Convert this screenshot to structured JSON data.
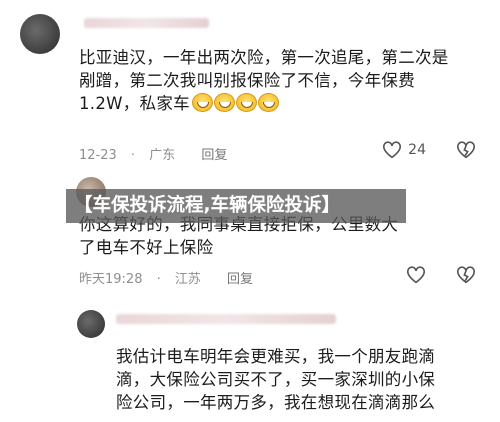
{
  "comments": [
    {
      "text_lines": [
        "比亚迪汉，一年出两次险，第一次追尾，第二次是",
        "剐蹭，第二次我叫别报保险了不信，今年保费",
        "1.2W，私家车"
      ],
      "time": "12-23",
      "location": "广东",
      "reply_label": "回复",
      "likes": "24"
    },
    {
      "text_lines": [
        "你这算好的，我同事桌直接拒保，公里数大",
        "了电车不好上保险"
      ],
      "time": "昨天19:28",
      "location": "江苏",
      "reply_label": "回复"
    },
    {
      "text_lines": [
        "我估计电车明年会更难买，我一个朋友跑滴",
        "滴，大保险公司买不了，买一家深圳的小保",
        "险公司，一年两万多，我在想现在滴滴那么"
      ]
    }
  ],
  "banner": {
    "title": "【车保投诉流程,车辆保险投诉】"
  },
  "icons": {
    "like": "heart-outline-icon",
    "dislike": "broken-heart-icon",
    "emoji": "grin-emoji-icon"
  },
  "colors": {
    "meta": "#8f8f8f",
    "banner_bg": "#5a5a5a"
  }
}
